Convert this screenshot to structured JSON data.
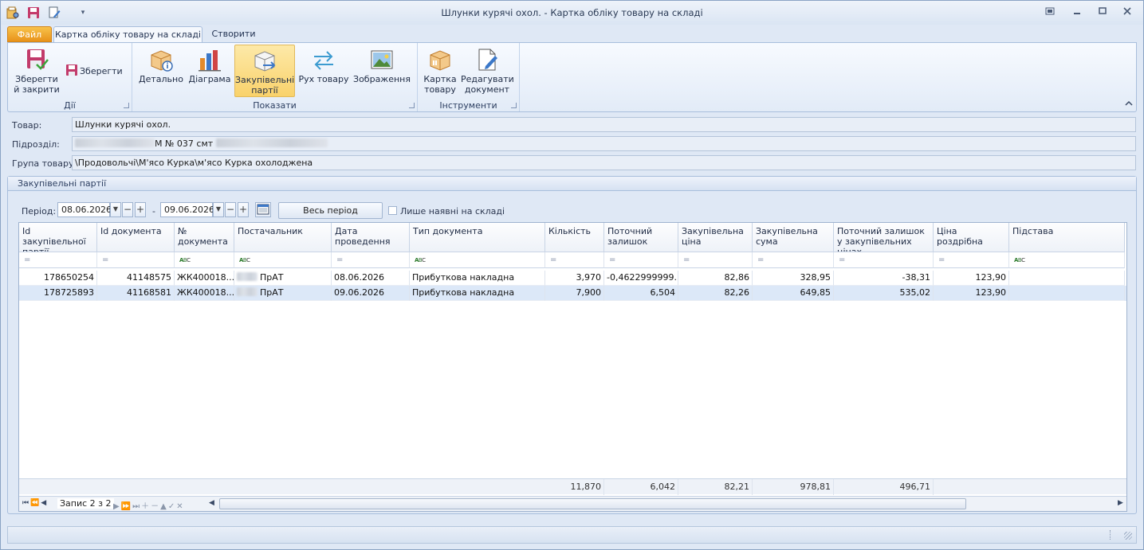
{
  "window": {
    "title": "Шлунки курячі охол. - Картка обліку товару на складі"
  },
  "tabs": {
    "file": "Файл",
    "active": "Картка обліку товару на складі",
    "create": "Створити"
  },
  "ribbon": {
    "actions": {
      "label": "Дії",
      "save_close": [
        "Зберегти",
        "й закрити"
      ],
      "save": "Зберегти"
    },
    "show": {
      "label": "Показати",
      "detail": "Детально",
      "diagram": "Діаграма",
      "purchase_batches": [
        "Закупівельні",
        "партії"
      ],
      "movement": "Рух товару",
      "image": "Зображення"
    },
    "tools": {
      "label": "Інструменти",
      "card": [
        "Картка",
        "товару"
      ],
      "edit": [
        "Редагувати",
        "документ"
      ]
    }
  },
  "fields": {
    "product_label": "Товар:",
    "product_value": "Шлунки курячі охол.",
    "division_label": "Підрозділ:",
    "division_value": "М № 037 смт",
    "group_label": "Група товару:",
    "group_value": "\\Продовольчі\\М'ясо Курка\\м'ясо Курка охолоджена"
  },
  "panel": {
    "title": "Закупівельні партії",
    "period_label": "Період:",
    "date_from": "08.06.2026",
    "date_to": "09.06.2026",
    "dash": "-",
    "whole_period": "Весь період",
    "only_in_stock": "Лише наявні на складі"
  },
  "grid": {
    "columns": [
      "Id закупівельної партії",
      "Id документа",
      "№ документа",
      "Постачальник",
      "Дата проведення",
      "Тип документа",
      "Кількість",
      "Поточний залишок",
      "Закупівельна ціна",
      "Закупівельна сума",
      "Поточний залишок у закупівельних цінах",
      "Ціна роздрібна",
      "Підстава"
    ],
    "rows": [
      {
        "batch_id": "178650254",
        "doc_id": "41148575",
        "doc_no": "ЖК400018...",
        "supplier": "ПрАТ",
        "date": "08.06.2026",
        "doc_type": "Прибуткова накладна",
        "qty": "3,970",
        "balance": "-0,4622999999...",
        "price": "82,86",
        "sum": "328,95",
        "balance_cost": "-38,31",
        "retail": "123,90",
        "basis": ""
      },
      {
        "batch_id": "178725893",
        "doc_id": "41168581",
        "doc_no": "ЖК400018...",
        "supplier": "ПрАТ",
        "date": "09.06.2026",
        "doc_type": "Прибуткова накладна",
        "qty": "7,900",
        "balance": "6,504",
        "price": "82,26",
        "sum": "649,85",
        "balance_cost": "535,02",
        "retail": "123,90",
        "basis": ""
      }
    ],
    "totals": {
      "qty": "11,870",
      "balance": "6,042",
      "price": "82,21",
      "sum": "978,81",
      "balance_cost": "496,71"
    },
    "navigator": "Запис 2 з 2"
  }
}
